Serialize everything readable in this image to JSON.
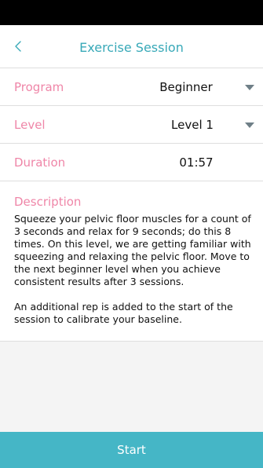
{
  "header": {
    "title": "Exercise Session",
    "back_icon": "chevron-left-icon"
  },
  "settings": {
    "program": {
      "label": "Program",
      "value": "Beginner",
      "icon": "caret-down-icon"
    },
    "level": {
      "label": "Level",
      "value": "Level 1",
      "icon": "caret-down-icon"
    },
    "duration": {
      "label": "Duration",
      "value": "01:57"
    }
  },
  "description": {
    "label": "Description",
    "text": "Squeeze your pelvic floor muscles for a count of 3 seconds and relax for 9 seconds; do this 8 times. On this level, we are getting familiar with squeezing and relaxing the pelvic floor. Move to the next beginner level when you achieve consistent results after 3 sessions.\n\nAn additional rep is added to the start of the session to calibrate your baseline."
  },
  "actions": {
    "start_label": "Start"
  },
  "colors": {
    "accent": "#38a9b8",
    "label_pink": "#ef86a8",
    "button_bg": "#45b6c6",
    "caret": "#6f7f87"
  }
}
